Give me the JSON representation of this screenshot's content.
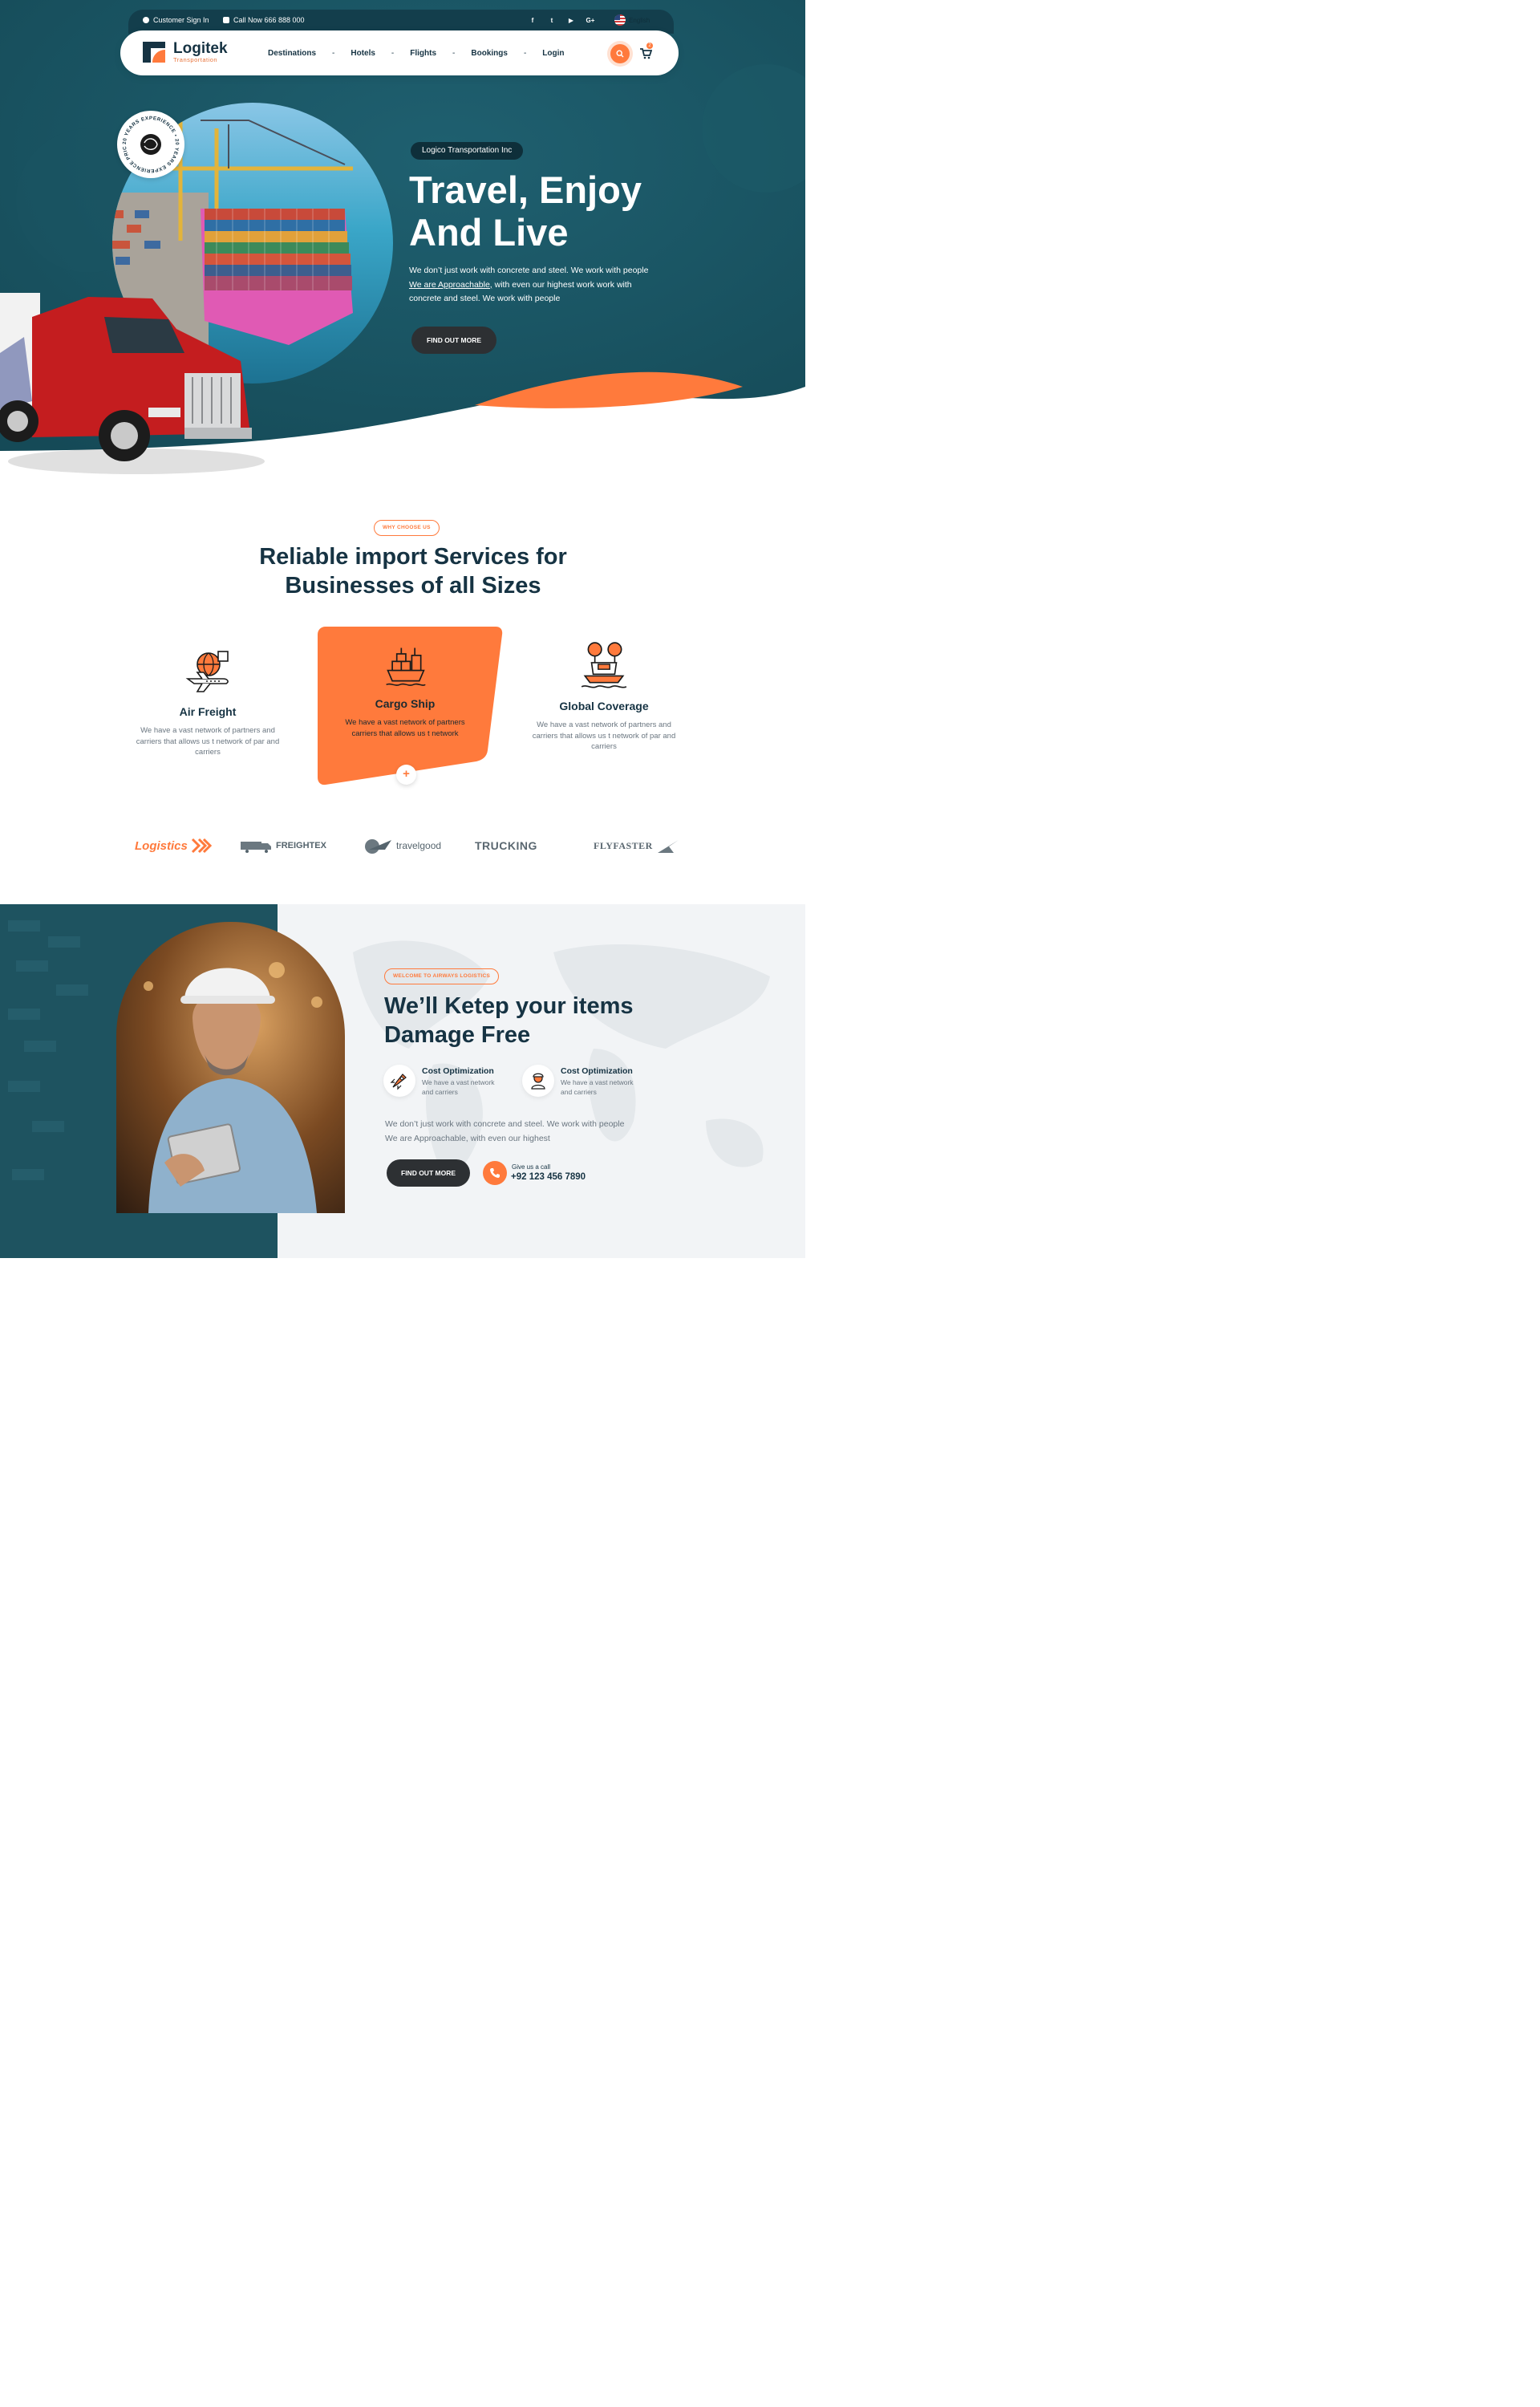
{
  "topbar": {
    "signin": "Customer Sign In",
    "call": "Call Now 666 888 000",
    "social": [
      "f",
      "t",
      "▶",
      "G+"
    ],
    "social_icons": [
      "facebook-icon",
      "twitter-icon",
      "youtube-icon",
      "google-plus-icon"
    ],
    "language": "English"
  },
  "brand": {
    "name": "Logitek",
    "tagline": "Transportation"
  },
  "nav": {
    "items": [
      "Destinations",
      "Hotels",
      "Flights",
      "Bookings",
      "Login"
    ],
    "separator": "-"
  },
  "cart": {
    "count": "2"
  },
  "hero": {
    "pill": "Logico Transportation Inc",
    "title_line1": "Travel, Enjoy",
    "title_line2": "And Live",
    "text_line1": "We don’t just work with concrete and steel. We work  with people",
    "text_line2_link": "We are Approachable,",
    "text_line2_rest": " with even  our highest work work with",
    "text_line3": "concrete and steel. We work  with people",
    "button": "FIND OUT MORE",
    "badge_text": "20 YEARS EXPERIENCE • 20 YEARS EXPERIENCE PRICE •"
  },
  "why": {
    "tag": "WHY CHOOSE US",
    "title_line1": "Reliable import Services for",
    "title_line2": "Businesses of all Sizes",
    "services": [
      {
        "title": "Air Freight",
        "text": "We have a vast network of partners and carriers that allows us t network of par and carriers",
        "icon": "air-freight-icon"
      },
      {
        "title": "Cargo Ship",
        "text": "We have a vast network of partners carriers that allows us t network",
        "icon": "cargo-ship-icon"
      },
      {
        "title": "Global Coverage",
        "text": "We have a vast network of partners and carriers that allows us t network of par and carriers",
        "icon": "global-coverage-icon"
      }
    ],
    "plus": "+"
  },
  "brands": [
    "Logistics",
    "FREIGHTEX",
    "travelgood",
    "TRUCKING",
    "FLYFASTER"
  ],
  "damage": {
    "tag": "WELCOME TO AIRWAYS LOGISTICS",
    "title_line1": "We’ll Ketep your items",
    "title_line2": "Damage Free",
    "features": [
      {
        "title": "Cost Optimization",
        "text": "We have a vast network and carriers"
      },
      {
        "title": "Cost Optimization",
        "text": "We have a vast network and carriers"
      }
    ],
    "text_line1": "We don’t just work with concrete and steel. We work  with people",
    "text_line2": "We are Approachable, with even  our highest",
    "button": "FIND OUT MORE",
    "call_label": "Give us a call",
    "call_number": "+92 123 456 7890"
  },
  "colors": {
    "teal": "#1a5664",
    "dark_teal": "#133e4c",
    "orange": "#ff7a3c",
    "navy_text": "#163343"
  }
}
